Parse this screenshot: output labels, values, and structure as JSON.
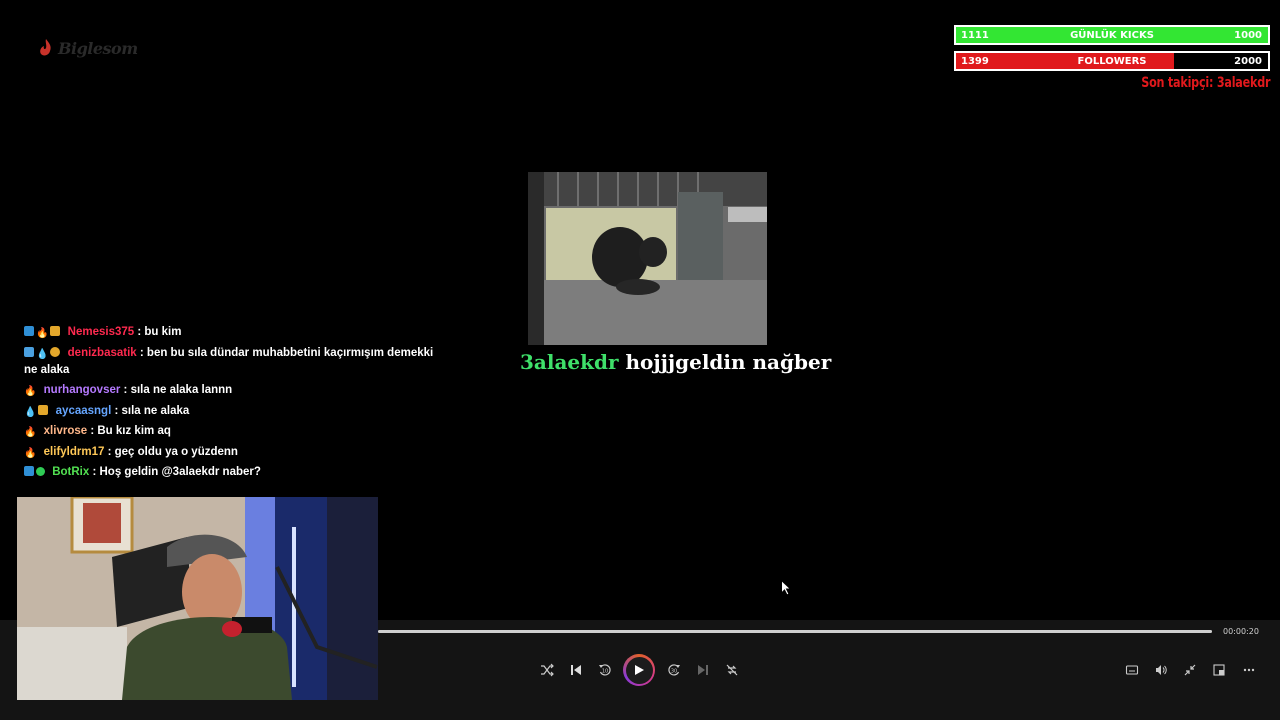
{
  "stream_logo": {
    "text": "Biglesom"
  },
  "goals": {
    "kicks": {
      "current": "1111",
      "label": "GÜNLÜK KICKS",
      "max": "1000",
      "progress": 1.0,
      "color": "#33e633"
    },
    "followers": {
      "current": "1399",
      "label": "FOLLOWERS",
      "max": "2000",
      "progress": 0.6995,
      "color": "#e0191c"
    }
  },
  "last_follower": "Son takipçi: 3alaekdr",
  "chat": {
    "messages": [
      {
        "user": "Nemesis375",
        "text": ": bu kim"
      },
      {
        "user": "denizbasatik",
        "text": ": ben bu sıla dündar muhabbetini kaçırmışım demekki ne alaka"
      },
      {
        "user": "nurhangovser",
        "text": ": sıla ne alaka lannn"
      },
      {
        "user": "aycaasngl",
        "text": ": sıla ne alaka"
      },
      {
        "user": "xlivrose",
        "text": ": Bu kız kim aq"
      },
      {
        "user": "elifyldrm17",
        "text": ": geç oldu ya o yüzdenn"
      },
      {
        "user": "BotRix",
        "text": ": Hoş geldin @3alaekdr naber?"
      }
    ]
  },
  "alert": {
    "name": "3alaekdr",
    "message": "hojjjgeldin nağber"
  },
  "player": {
    "time": "00:00:20",
    "progress": 1.0,
    "accent_colors": [
      "#e0602a",
      "#d63a8a",
      "#8a3ad6"
    ]
  },
  "icons": {
    "shuffle": "shuffle-icon",
    "prev": "skip-previous-icon",
    "rewind": "rewind-10-icon",
    "play": "play-icon",
    "forward": "forward-30-icon",
    "next": "skip-next-icon",
    "repeat": "repeat-off-icon",
    "captions": "captions-icon",
    "volume": "volume-icon",
    "minimize": "minimize-icon",
    "popout": "popout-icon",
    "more": "more-icon"
  }
}
